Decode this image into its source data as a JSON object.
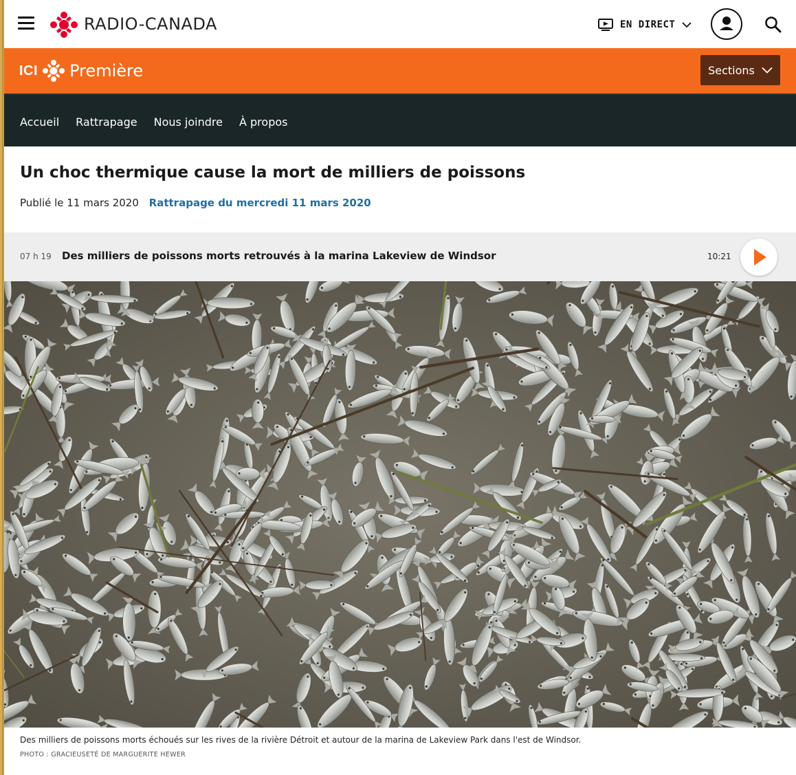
{
  "header": {
    "brand": "RADIO-CANADA",
    "live_label": "EN DIRECT"
  },
  "station": {
    "prefix": "ICI",
    "name": "Première",
    "sections_label": "Sections"
  },
  "nav": {
    "items": [
      {
        "label": "Accueil"
      },
      {
        "label": "Rattrapage"
      },
      {
        "label": "Nous joindre"
      },
      {
        "label": "À propos"
      }
    ]
  },
  "article": {
    "title": "Un choc thermique cause la mort de milliers de poissons",
    "published": "Publié le 11 mars 2020",
    "replay_link": "Rattrapage du mercredi 11 mars 2020"
  },
  "audio": {
    "time": "07 h 19",
    "segment_title": "Des milliers de poissons morts retrouvés à la marina Lakeview de Windsor",
    "duration": "10:21"
  },
  "photo": {
    "caption": "Des milliers de poissons morts échoués sur les rives de la rivière Détroit et autour de la marina de Lakeview Park dans l'est de Windsor.",
    "credit": "PHOTO : GRACIEUSETÉ DE MARGUERITE HEWER"
  },
  "colors": {
    "accent_orange": "#f46a1c",
    "sections_button": "#5a2b12",
    "nav_dark": "#1b2628",
    "link_blue": "#1f6fa5",
    "cbc_red": "#e4002b"
  }
}
